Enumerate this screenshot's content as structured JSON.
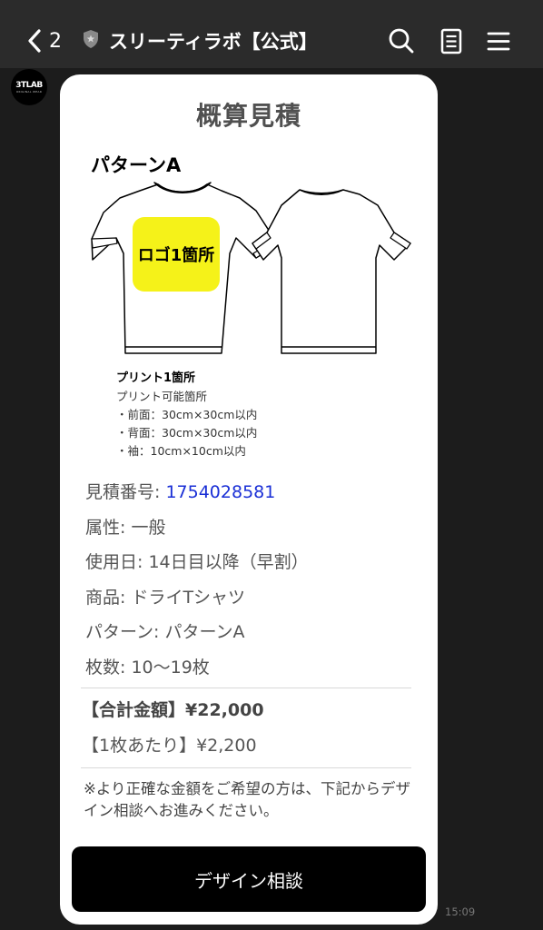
{
  "header": {
    "back_count": "2",
    "title": "スリーティラボ【公式】"
  },
  "avatar": {
    "logo_text": "3TLAB",
    "logo_subtext": "ORIGINAL WEAR"
  },
  "card": {
    "title": "概算見積",
    "pattern_label": "パターンA",
    "logo_box_text": "ロゴ1箇所",
    "print_info": {
      "title": "プリント1箇所",
      "subtitle": "プリント可能箇所",
      "lines": [
        "・前面：30cm×30cm以内",
        "・背面：30cm×30cm以内",
        "・袖：10cm×10cm以内"
      ]
    },
    "details": {
      "quote_number_label": "見積番号: ",
      "quote_number": "1754028581",
      "attribute": "属性: 一般",
      "use_date": "使用日: 14日目以降（早割）",
      "product": "商品: ドライTシャツ",
      "pattern": "パターン: パターンA",
      "quantity": "枚数: 10〜19枚"
    },
    "totals": {
      "total": "【合計金額】¥22,000",
      "per_unit": "【1枚あたり】¥2,200"
    },
    "note": "※より正確な金額をご希望の方は、下記からデザイン相談へお進みください。",
    "cta_label": "デザイン相談"
  },
  "timestamp": "15:09",
  "colors": {
    "background": "#1c1c1c",
    "header": "#2b2b2b",
    "quote_number": "#1a2fd6",
    "logo_box": "#f5f219",
    "cta": "#000000"
  },
  "icons": [
    "chevron-left-icon",
    "shield-icon",
    "search-icon",
    "notes-icon",
    "menu-icon"
  ]
}
